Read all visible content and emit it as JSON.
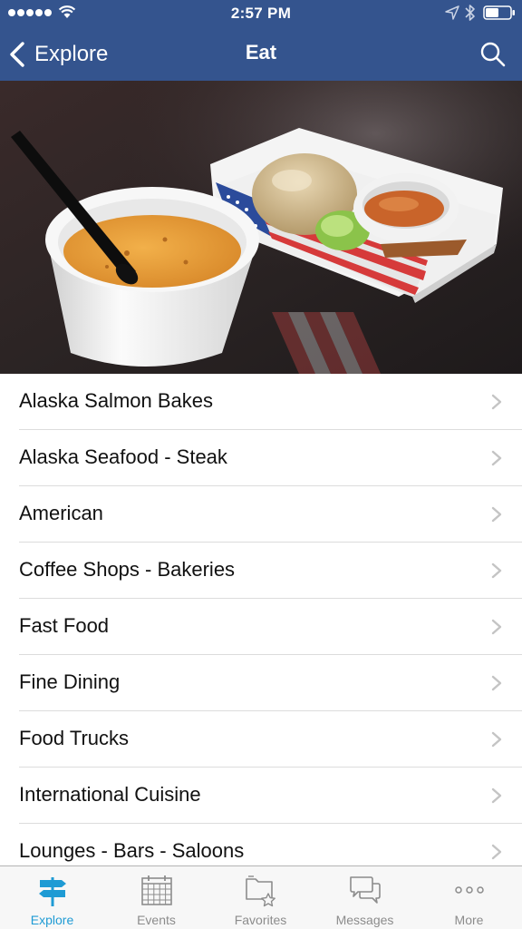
{
  "status_bar": {
    "time": "2:57 PM"
  },
  "nav": {
    "back_label": "Explore",
    "title": "Eat"
  },
  "hero": {
    "description_icon": "food-photo"
  },
  "categories": [
    {
      "label": "Alaska Salmon Bakes"
    },
    {
      "label": "Alaska Seafood - Steak"
    },
    {
      "label": "American"
    },
    {
      "label": "Coffee Shops - Bakeries"
    },
    {
      "label": "Fast Food"
    },
    {
      "label": "Fine Dining"
    },
    {
      "label": "Food Trucks"
    },
    {
      "label": "International Cuisine"
    },
    {
      "label": "Lounges - Bars - Saloons"
    }
  ],
  "tabs": [
    {
      "label": "Explore",
      "icon": "signpost-icon",
      "active": true
    },
    {
      "label": "Events",
      "icon": "calendar-icon",
      "active": false
    },
    {
      "label": "Favorites",
      "icon": "favorites-icon",
      "active": false
    },
    {
      "label": "Messages",
      "icon": "messages-icon",
      "active": false
    },
    {
      "label": "More",
      "icon": "more-icon",
      "active": false
    }
  ],
  "colors": {
    "nav_background": "#34548e",
    "tab_active": "#1f9bd4",
    "tab_inactive": "#8c8c8c"
  }
}
